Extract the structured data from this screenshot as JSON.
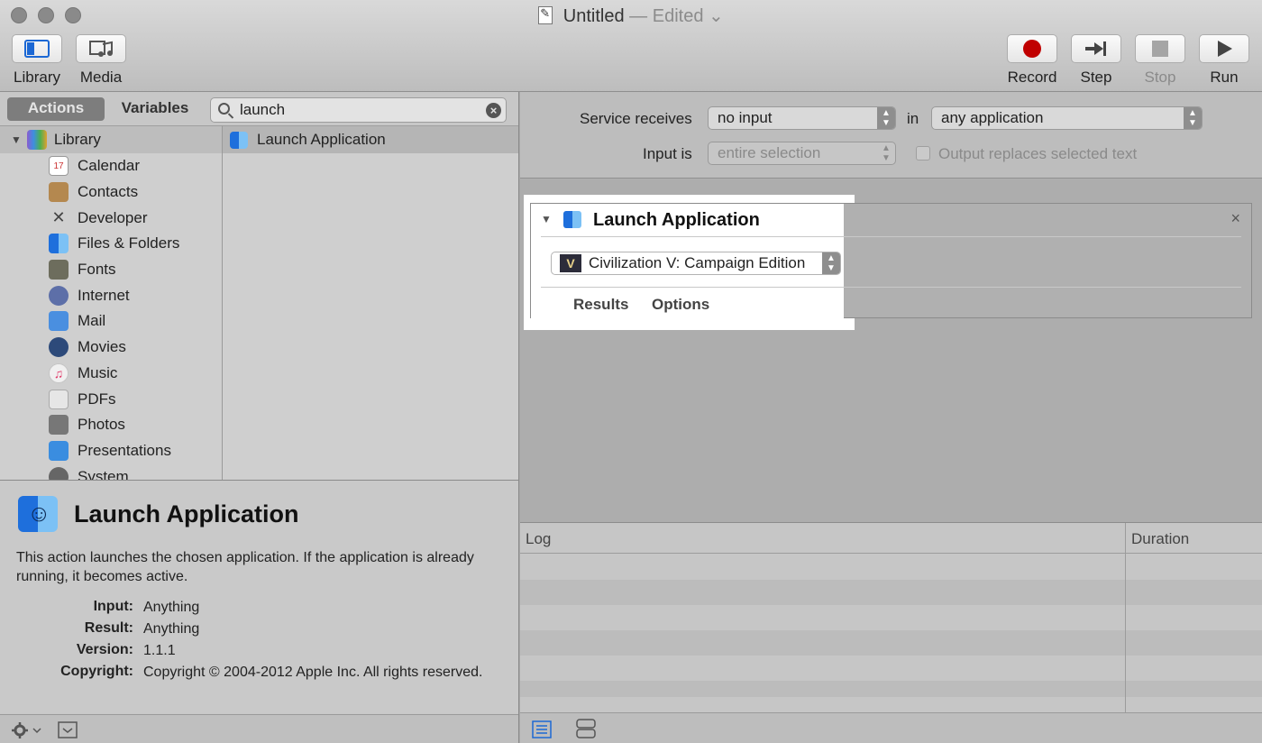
{
  "window": {
    "title": "Untitled",
    "status": "— Edited",
    "status_chevron": "⌄"
  },
  "toolbar": {
    "library_label": "Library",
    "media_label": "Media",
    "record_label": "Record",
    "step_label": "Step",
    "stop_label": "Stop",
    "run_label": "Run"
  },
  "library_panel": {
    "actions_tab": "Actions",
    "variables_tab": "Variables",
    "search_value": "launch",
    "root_label": "Library",
    "categories": [
      {
        "label": "Calendar",
        "icon": "calendar-icon"
      },
      {
        "label": "Contacts",
        "icon": "contacts-icon"
      },
      {
        "label": "Developer",
        "icon": "developer-icon"
      },
      {
        "label": "Files & Folders",
        "icon": "finder-icon"
      },
      {
        "label": "Fonts",
        "icon": "fonts-icon"
      },
      {
        "label": "Internet",
        "icon": "internet-icon"
      },
      {
        "label": "Mail",
        "icon": "mail-icon"
      },
      {
        "label": "Movies",
        "icon": "movies-icon"
      },
      {
        "label": "Music",
        "icon": "music-icon"
      },
      {
        "label": "PDFs",
        "icon": "pdf-icon"
      },
      {
        "label": "Photos",
        "icon": "photos-icon"
      },
      {
        "label": "Presentations",
        "icon": "presentations-icon"
      },
      {
        "label": "System",
        "icon": "system-icon"
      }
    ],
    "calendar_day": "17",
    "results": [
      {
        "label": "Launch Application",
        "icon": "finder-icon"
      }
    ]
  },
  "description": {
    "title": "Launch Application",
    "text": "This action launches the chosen application. If the application is already running, it becomes active.",
    "input_key": "Input:",
    "input_val": "Anything",
    "result_key": "Result:",
    "result_val": "Anything",
    "version_key": "Version:",
    "version_val": "1.1.1",
    "copyright_key": "Copyright:",
    "copyright_val": "Copyright © 2004-2012 Apple Inc.  All rights reserved."
  },
  "service": {
    "receives_label": "Service receives",
    "receives_value": "no input",
    "in_label": "in",
    "in_value": "any application",
    "input_is_label": "Input is",
    "input_is_value": "entire selection",
    "replaces_label": "Output replaces selected text"
  },
  "action_card": {
    "title": "Launch Application",
    "close_glyph": "×",
    "app_value": "Civilization V: Campaign Edition",
    "app_icon_glyph": "V",
    "results_tab": "Results",
    "options_tab": "Options"
  },
  "log": {
    "log_header": "Log",
    "duration_header": "Duration"
  },
  "colors": {
    "record_red": "#c00000",
    "finder_blue": "#1e6fdc",
    "highlight": "#ffffff"
  }
}
